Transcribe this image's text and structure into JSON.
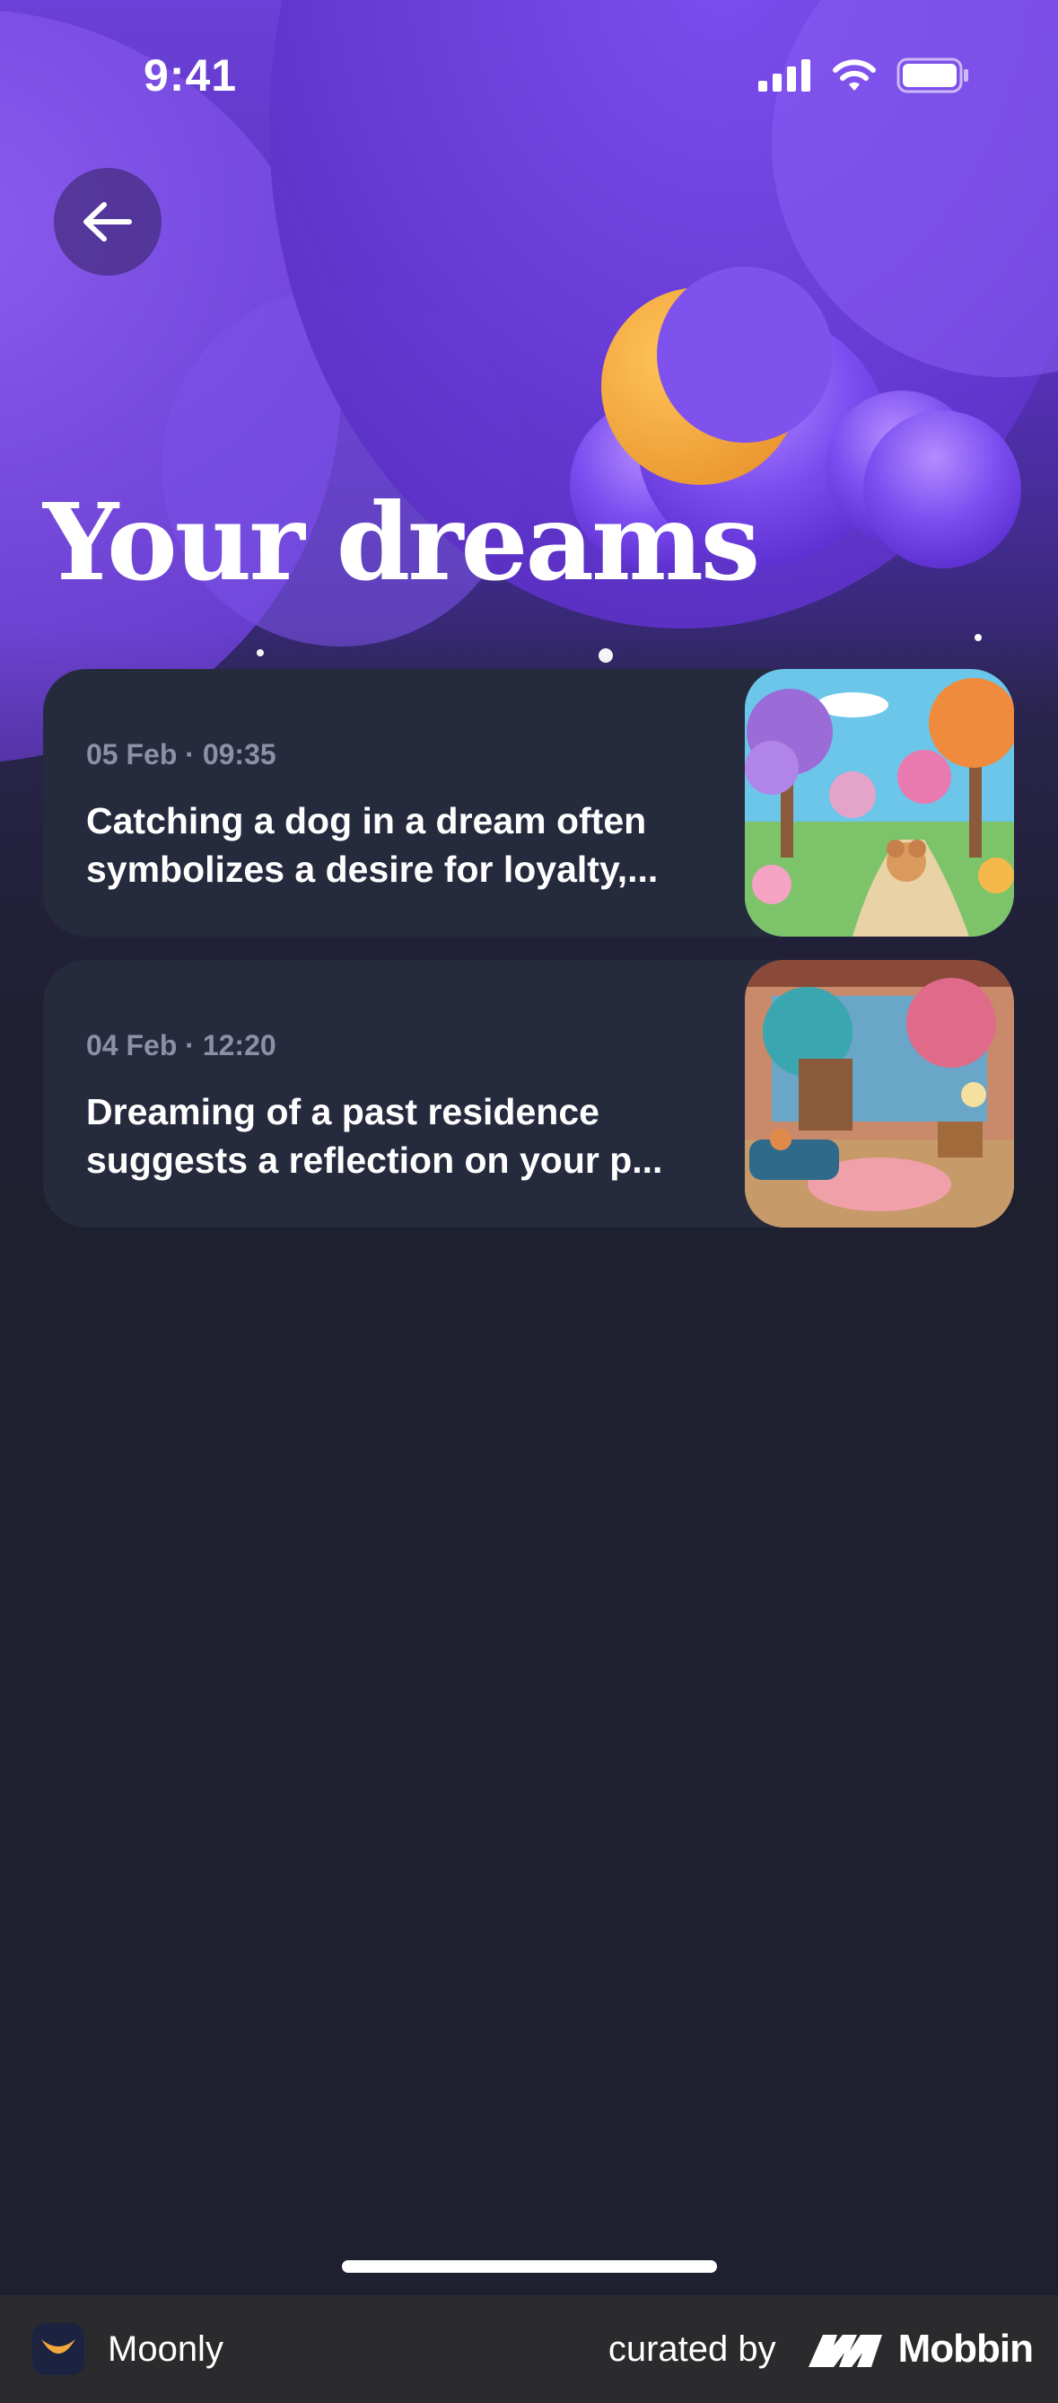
{
  "status_bar": {
    "time": "9:41"
  },
  "header": {
    "title": "Your dreams"
  },
  "dreams": [
    {
      "date": "05 Feb · 09:35",
      "text_line1": "Catching a dog in a dream often",
      "text_line2": "symbolizes a desire for loyalty,..."
    },
    {
      "date": "04 Feb · 12:20",
      "text_line1": "Dreaming of a past residence",
      "text_line2": "suggests a reflection on your p..."
    }
  ],
  "footer": {
    "app_name": "Moonly",
    "curated_label": "curated by",
    "brand_name": "Mobbin"
  },
  "colors": {
    "background": "#1e1f2f",
    "card": "#262a3d",
    "accent_purple": "#6c40d8",
    "moon": "#f3a83d",
    "date_text": "#8a90a8"
  }
}
